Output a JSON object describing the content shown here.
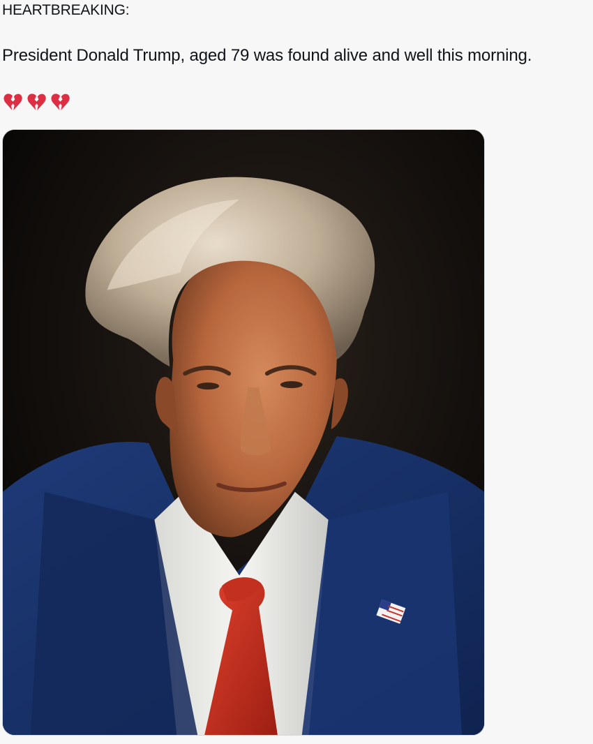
{
  "post": {
    "headline": "HEARTBREAKING:",
    "body": "President Donald Trump, aged 79 was found alive and well this morning.",
    "emojis": [
      "broken-heart-icon",
      "broken-heart-icon",
      "broken-heart-icon"
    ],
    "media": {
      "subject": "portrait-photo"
    }
  },
  "colors": {
    "background": "#f7f7f7",
    "text": "#0f1419",
    "broken_heart": "#dd2e44",
    "media_border": "#cfd9de"
  }
}
